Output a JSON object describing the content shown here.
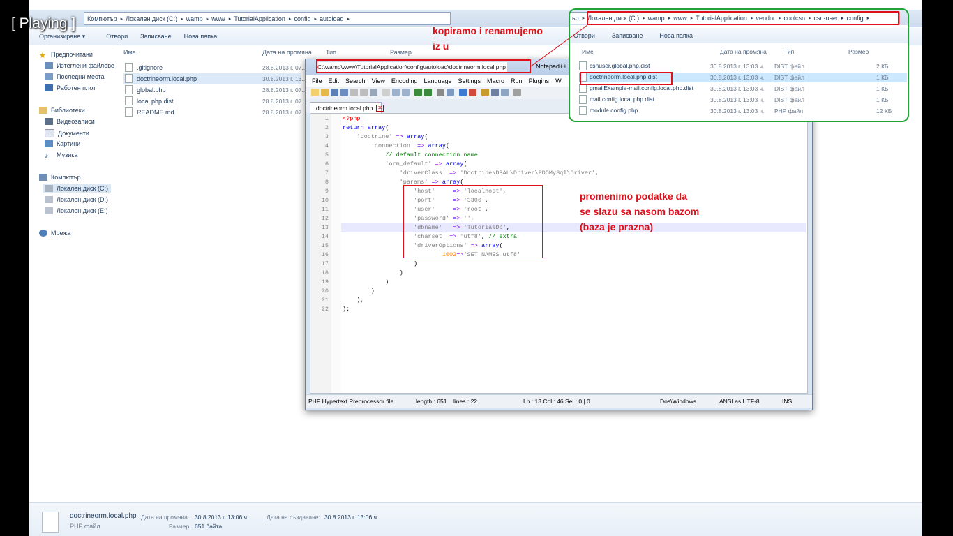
{
  "overlay": {
    "playing_label": "[ Playing ]"
  },
  "explorer": {
    "breadcrumbs": [
      "Компютър",
      "Локален диск (C:)",
      "wamp",
      "www",
      "TutorialApplication",
      "config",
      "autoload"
    ],
    "toolbar": {
      "organize": "Организиране ▾",
      "open": "Отвори",
      "write": "Записване",
      "new_folder": "Нова папка"
    },
    "sidebar": {
      "favorites": "Предпочитани",
      "fav_items": [
        "Изтеглени файлове",
        "Последни места",
        "Работен плот"
      ],
      "libraries": "Библиотеки",
      "lib_items": [
        "Видеозаписи",
        "Документи",
        "Картини",
        "Музика"
      ],
      "computer": "Компютър",
      "comp_items": [
        "Локален диск (C:)",
        "Локален диск (D:)",
        "Локален диск (E:)"
      ],
      "network": "Мрежа"
    },
    "columns": {
      "name": "Име",
      "date": "Дата на промяна",
      "type": "Тип",
      "size": "Размер"
    },
    "files": [
      {
        "name": ".gitignore",
        "date": "28.8.2013 г. 07..."
      },
      {
        "name": "doctrineorm.local.php",
        "date": "30.8.2013 г. 13..."
      },
      {
        "name": "global.php",
        "date": "28.8.2013 г. 07..."
      },
      {
        "name": "local.php.dist",
        "date": "28.8.2013 г. 07..."
      },
      {
        "name": "README.md",
        "date": "28.8.2013 г. 07..."
      }
    ],
    "details": {
      "filename": "doctrineorm.local.php",
      "filetype": "PHP файл",
      "modified_label": "Дата на промяна:",
      "modified": "30.8.2013 г. 13:06 ч.",
      "created_label": "Дата на създаване:",
      "created": "30.8.2013 г. 13:06 ч.",
      "size_label": "Размер:",
      "size": "651 байта"
    }
  },
  "right_explorer": {
    "breadcrumbs": [
      "ър",
      "Локален диск (C:)",
      "wamp",
      "www",
      "TutorialApplication",
      "vendor",
      "coolcsn",
      "csn-user",
      "config"
    ],
    "toolbar": {
      "open": "Отвори",
      "write": "Записване",
      "new_folder": "Нова папка"
    },
    "columns": {
      "name": "Име",
      "date": "Дата на промяна",
      "type": "Тип",
      "size": "Размер"
    },
    "files": [
      {
        "name": "csnuser.global.php.dist",
        "date": "30.8.2013 г. 13:03 ч.",
        "type": "DIST файл",
        "size": "2 КБ"
      },
      {
        "name": "doctrineorm.local.php.dist",
        "date": "30.8.2013 г. 13:03 ч.",
        "type": "DIST файл",
        "size": "1 КБ"
      },
      {
        "name": "gmailExample-mail.config.local.php.dist",
        "date": "30.8.2013 г. 13:03 ч.",
        "type": "DIST файл",
        "size": "1 КБ"
      },
      {
        "name": "mail.config.local.php.dist",
        "date": "30.8.2013 г. 13:03 ч.",
        "type": "DIST файл",
        "size": "1 КБ"
      },
      {
        "name": "module.config.php",
        "date": "30.8.2013 г. 13:03 ч.",
        "type": "PHP файл",
        "size": "12 КБ"
      }
    ]
  },
  "notepad": {
    "path": "C:\\wamp\\www\\TutorialApplication\\config\\autoload\\doctrineorm.local.php",
    "app": "Notepad++",
    "menu": [
      "File",
      "Edit",
      "Search",
      "View",
      "Encoding",
      "Language",
      "Settings",
      "Macro",
      "Run",
      "Plugins",
      "W"
    ],
    "tab": "doctrineorm.local.php",
    "status": {
      "filetype": "PHP Hypertext Preprocessor file",
      "length": "length : 651",
      "lines": "lines : 22",
      "pos": "Ln : 13   Col : 46   Sel : 0 | 0",
      "eol": "Dos\\Windows",
      "enc": "ANSI as UTF-8",
      "ins": "INS"
    },
    "code": [
      "<?php",
      "return array(",
      "    'doctrine' => array(",
      "        'connection' => array(",
      "            // default connection name",
      "            'orm_default' => array(",
      "                'driverClass' => 'Doctrine\\DBAL\\Driver\\PDOMySql\\Driver',",
      "                'params' => array(",
      "                    'host'     => 'localhost',",
      "                    'port'     => '3306',",
      "                    'user'     => 'root',",
      "                    'password' => '',",
      "                    'dbname'   => 'TutorialDb',",
      "                    'charset' => 'utf8', // extra",
      "                    'driverOptions' => array(",
      "                            1002=>'SET NAMES utf8'",
      "                    )",
      "                )",
      "            )",
      "        )",
      "    ),",
      ");"
    ]
  },
  "annotations": {
    "copy_line1": "kopiramo i renamujemo",
    "copy_line2": "iz u",
    "params_line1": "promenimo podatke da",
    "params_line2": "se slazu sa nasom bazom",
    "params_line3": "(baza je prazna)"
  },
  "colors": {
    "highlight_red": "#e0101a",
    "highlight_green": "#21a336",
    "selected_row": "#cce8ff"
  }
}
